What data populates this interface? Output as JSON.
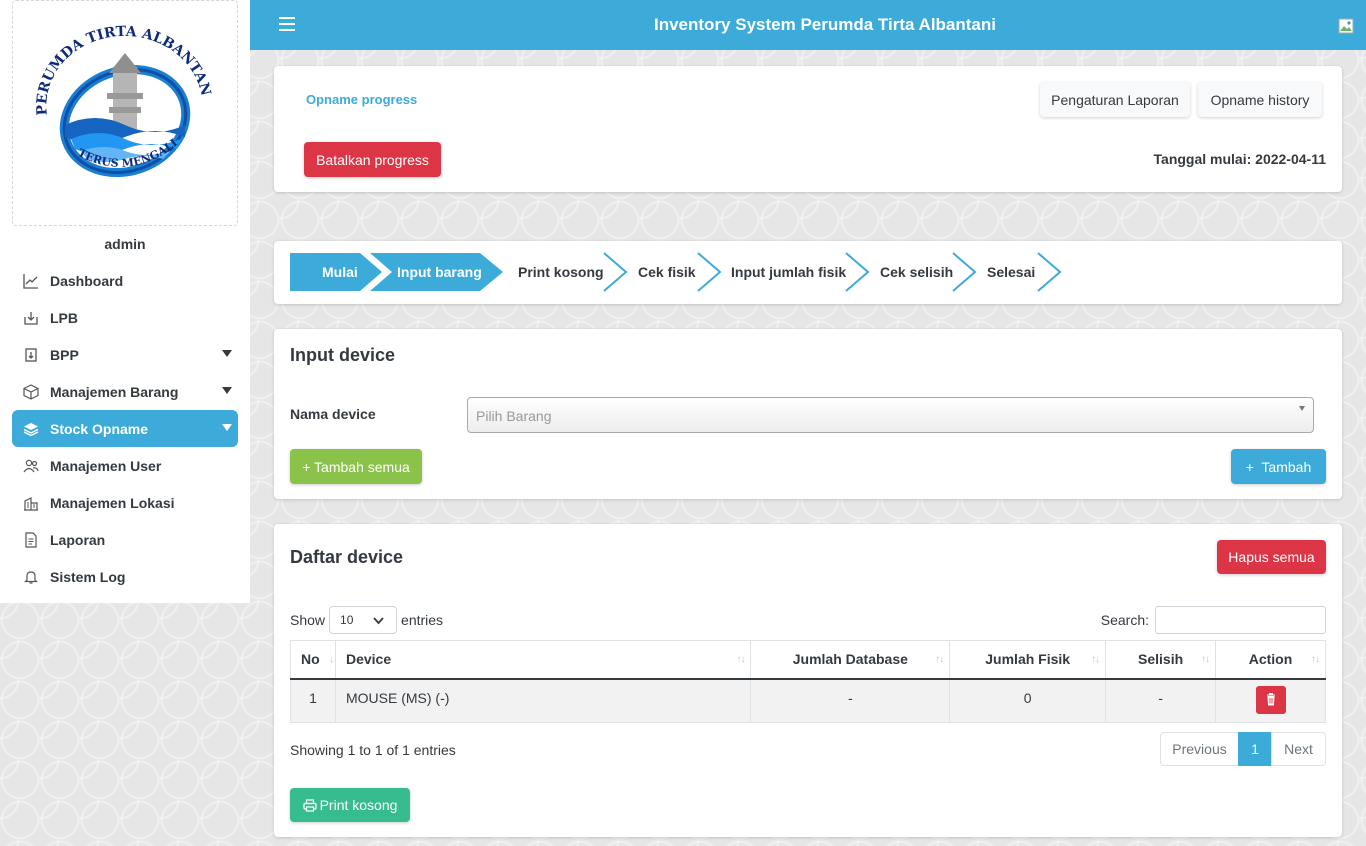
{
  "topbar": {
    "title": "Inventory System Perumda Tirta Albantani"
  },
  "logo": {
    "top_text": "PERUMDA TIRTA ALBANTANI",
    "bottom_text": "TERUS MENGALIR"
  },
  "sidebar": {
    "user": "admin",
    "items": [
      {
        "label": "Dashboard",
        "icon": "chart-icon",
        "has_submenu": false,
        "active": false
      },
      {
        "label": "LPB",
        "icon": "download-box-icon",
        "has_submenu": false,
        "active": false
      },
      {
        "label": "BPP",
        "icon": "download-icon",
        "has_submenu": true,
        "active": false
      },
      {
        "label": "Manajemen Barang",
        "icon": "box-icon",
        "has_submenu": true,
        "active": false
      },
      {
        "label": "Stock Opname",
        "icon": "layers-icon",
        "has_submenu": true,
        "active": true
      },
      {
        "label": "Manajemen User",
        "icon": "users-icon",
        "has_submenu": false,
        "active": false
      },
      {
        "label": "Manajemen Lokasi",
        "icon": "building-icon",
        "has_submenu": false,
        "active": false
      },
      {
        "label": "Laporan",
        "icon": "document-icon",
        "has_submenu": false,
        "active": false
      },
      {
        "label": "Sistem Log",
        "icon": "bell-icon",
        "has_submenu": false,
        "active": false
      }
    ]
  },
  "progress_card": {
    "title": "Opname progress",
    "cancel_label": "Batalkan progress",
    "settings_label": "Pengaturan Laporan",
    "history_label": "Opname history",
    "start_date_label": "Tanggal mulai:",
    "start_date": "2022-04-11"
  },
  "steps": [
    {
      "label": "Mulai",
      "state": "done"
    },
    {
      "label": "Input barang",
      "state": "current"
    },
    {
      "label": "Print kosong",
      "state": "pending"
    },
    {
      "label": "Cek fisik",
      "state": "pending"
    },
    {
      "label": "Input jumlah fisik",
      "state": "pending"
    },
    {
      "label": "Cek selisih",
      "state": "pending"
    },
    {
      "label": "Selesai",
      "state": "pending"
    }
  ],
  "input_card": {
    "title": "Input device",
    "field_label": "Nama device",
    "select_placeholder": "Pilih Barang",
    "add_all_label": "+ Tambah semua",
    "add_label": "+  Tambah"
  },
  "list_card": {
    "title": "Daftar device",
    "delete_all_label": "Hapus semua",
    "show_label": "Show",
    "entries_value": "10",
    "entries_label": "entries",
    "search_label": "Search:",
    "columns": [
      "No",
      "Device",
      "Jumlah Database",
      "Jumlah Fisik",
      "Selisih",
      "Action"
    ],
    "rows": [
      {
        "no": "1",
        "device": "MOUSE (MS) (-)",
        "jumlah_database": "-",
        "jumlah_fisik": "0",
        "selisih": "-"
      }
    ],
    "info": "Showing 1 to 1 of 1 entries",
    "pager": {
      "previous": "Previous",
      "current": "1",
      "next": "Next"
    },
    "print_label": "Print kosong"
  },
  "colors": {
    "primary": "#3cabd9",
    "danger": "#dc3545",
    "success": "#8bc34a",
    "teal": "#36bc8e"
  }
}
